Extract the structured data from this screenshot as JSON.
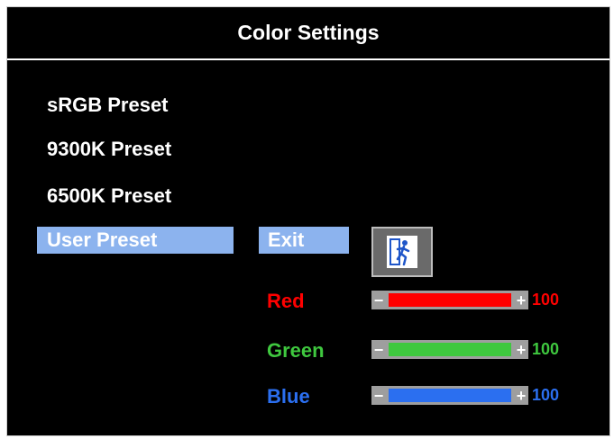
{
  "title": "Color Settings",
  "menu": {
    "items": [
      {
        "label": "sRGB Preset"
      },
      {
        "label": "9300K Preset"
      },
      {
        "label": "6500K Preset"
      },
      {
        "label": "User Preset",
        "selected": true
      }
    ]
  },
  "exit": {
    "label": "Exit",
    "icon": "exit-door-icon"
  },
  "channels": [
    {
      "label": "Red",
      "value": "100",
      "level": 1.0,
      "color": "#ff0000"
    },
    {
      "label": "Green",
      "value": "100",
      "level": 1.0,
      "color": "#3fc83f"
    },
    {
      "label": "Blue",
      "value": "100",
      "level": 1.0,
      "color": "#2b6ff0"
    }
  ],
  "colors": {
    "accent": "#8cb3ee",
    "background": "#000000",
    "bar_track": "#9e9e9e"
  },
  "bar_symbols": {
    "minus": "−",
    "plus": "+"
  }
}
